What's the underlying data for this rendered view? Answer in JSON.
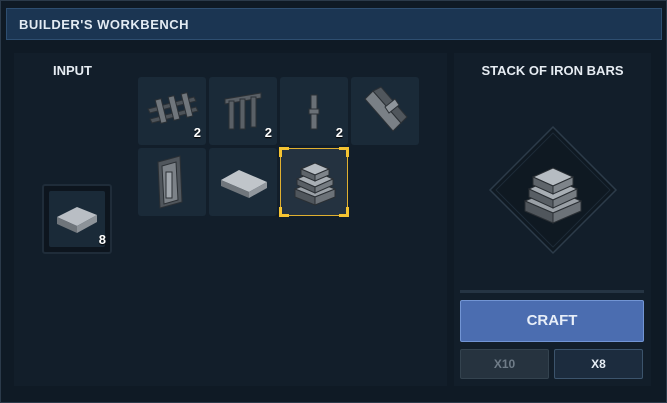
{
  "window": {
    "title": "BUILDER'S WORKBENCH"
  },
  "input": {
    "label": "INPUT",
    "slot": {
      "item": "iron-bar-icon",
      "count": "8"
    }
  },
  "recipes": [
    {
      "name": "rail-track-icon",
      "count": "2",
      "selected": false
    },
    {
      "name": "bar-fence-icon",
      "count": "2",
      "selected": false
    },
    {
      "name": "iron-rod-icon",
      "count": "2",
      "selected": false
    },
    {
      "name": "iron-beam-icon",
      "count": "",
      "selected": false
    },
    {
      "name": "iron-door-icon",
      "count": "",
      "selected": false
    },
    {
      "name": "iron-plate-icon",
      "count": "",
      "selected": false
    },
    {
      "name": "stack-of-iron-bars-icon",
      "count": "",
      "selected": true
    }
  ],
  "output": {
    "title": "STACK OF IRON BARS",
    "icon": "stack-of-iron-bars-icon"
  },
  "actions": {
    "craft_label": "CRAFT",
    "x10_label": "X10",
    "x8_label": "X8"
  },
  "colors": {
    "accent": "#4b6db0",
    "selection": "#f5c432",
    "titlebar": "#1b3552"
  }
}
